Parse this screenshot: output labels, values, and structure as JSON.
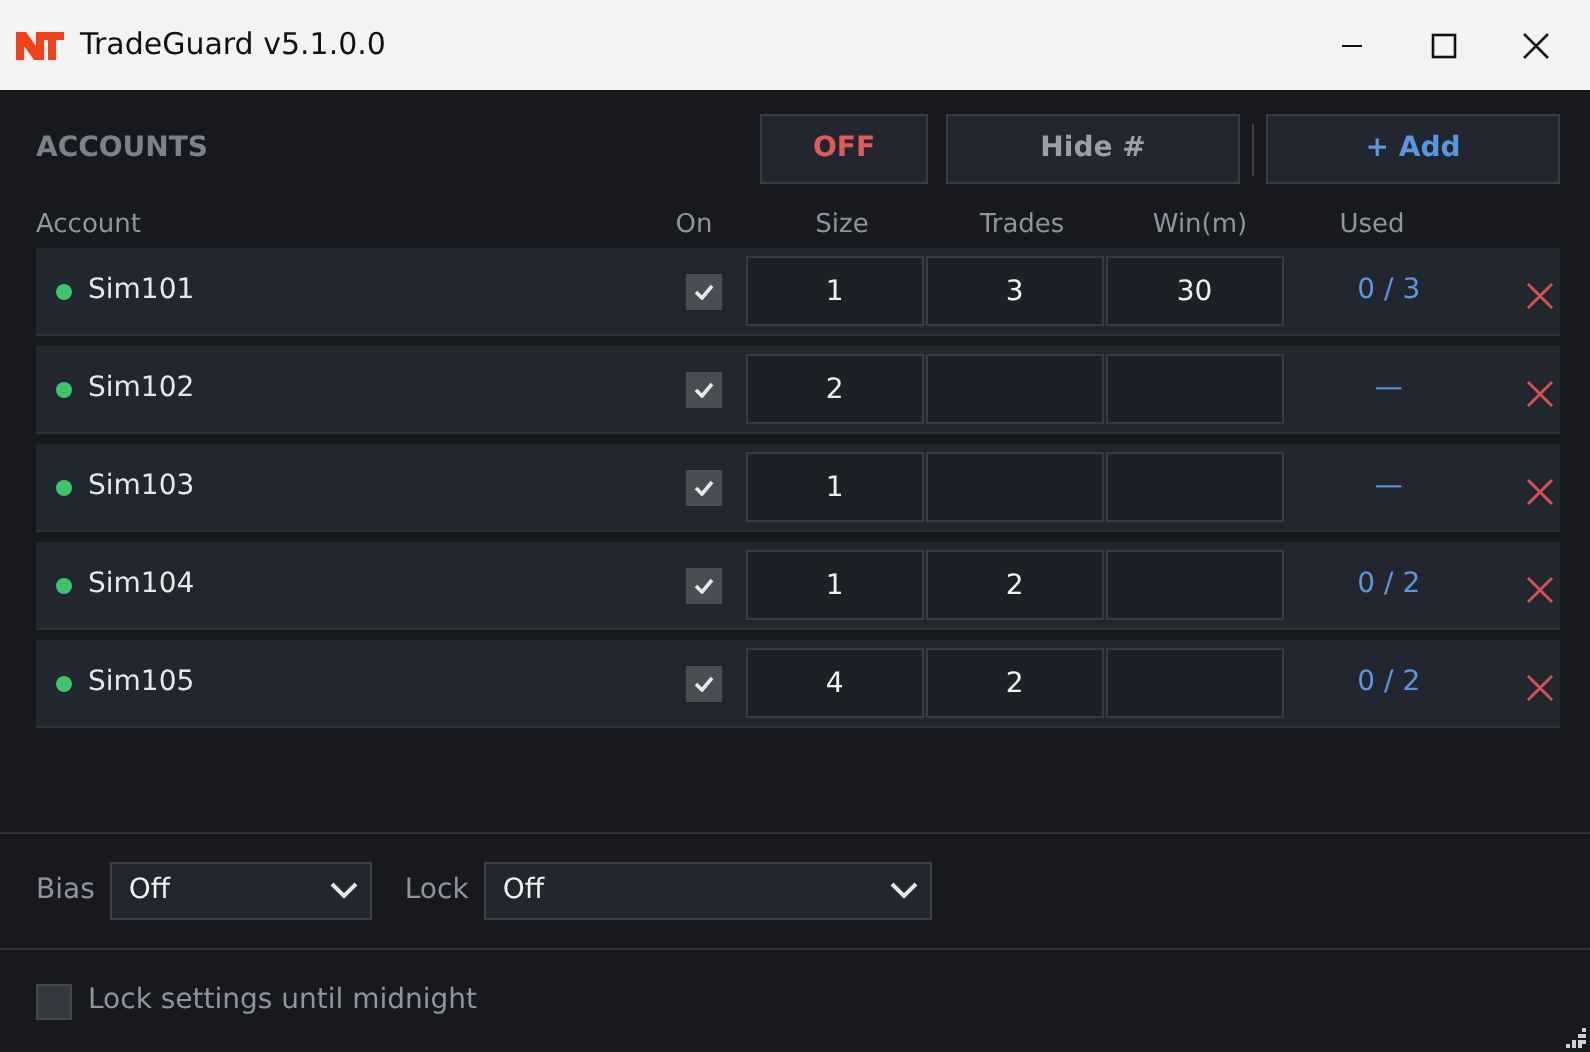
{
  "window": {
    "title": "TradeGuard v5.1.0.0"
  },
  "toolbar": {
    "heading": "ACCOUNTS",
    "buttons": [
      {
        "label": "OFF",
        "kind": "danger"
      },
      {
        "label": "Hide #",
        "kind": "plain"
      },
      {
        "label": "+ Add",
        "kind": "accent"
      }
    ]
  },
  "columns": [
    "Account",
    "On",
    "Size",
    "Trades",
    "Win(m)",
    "Used"
  ],
  "accounts": [
    {
      "name": "Sim101",
      "connected": true,
      "on": true,
      "size": "1",
      "trades": "3",
      "win": "30",
      "used": "0 / 3"
    },
    {
      "name": "Sim102",
      "connected": true,
      "on": true,
      "size": "2",
      "used": "—"
    },
    {
      "name": "Sim103",
      "connected": true,
      "on": true,
      "size": "1",
      "used": "—"
    },
    {
      "name": "Sim104",
      "connected": true,
      "on": true,
      "size": "1",
      "trades": "2",
      "used": "0 / 2"
    },
    {
      "name": "Sim105",
      "connected": true,
      "on": true,
      "size": "4",
      "trades": "2",
      "used": "0 / 2"
    }
  ],
  "bias": {
    "label": "Bias",
    "value": "Off"
  },
  "lock": {
    "label": "Lock",
    "value": "Off"
  },
  "lock_until_midnight": {
    "label": "Lock settings until midnight",
    "checked": false
  }
}
